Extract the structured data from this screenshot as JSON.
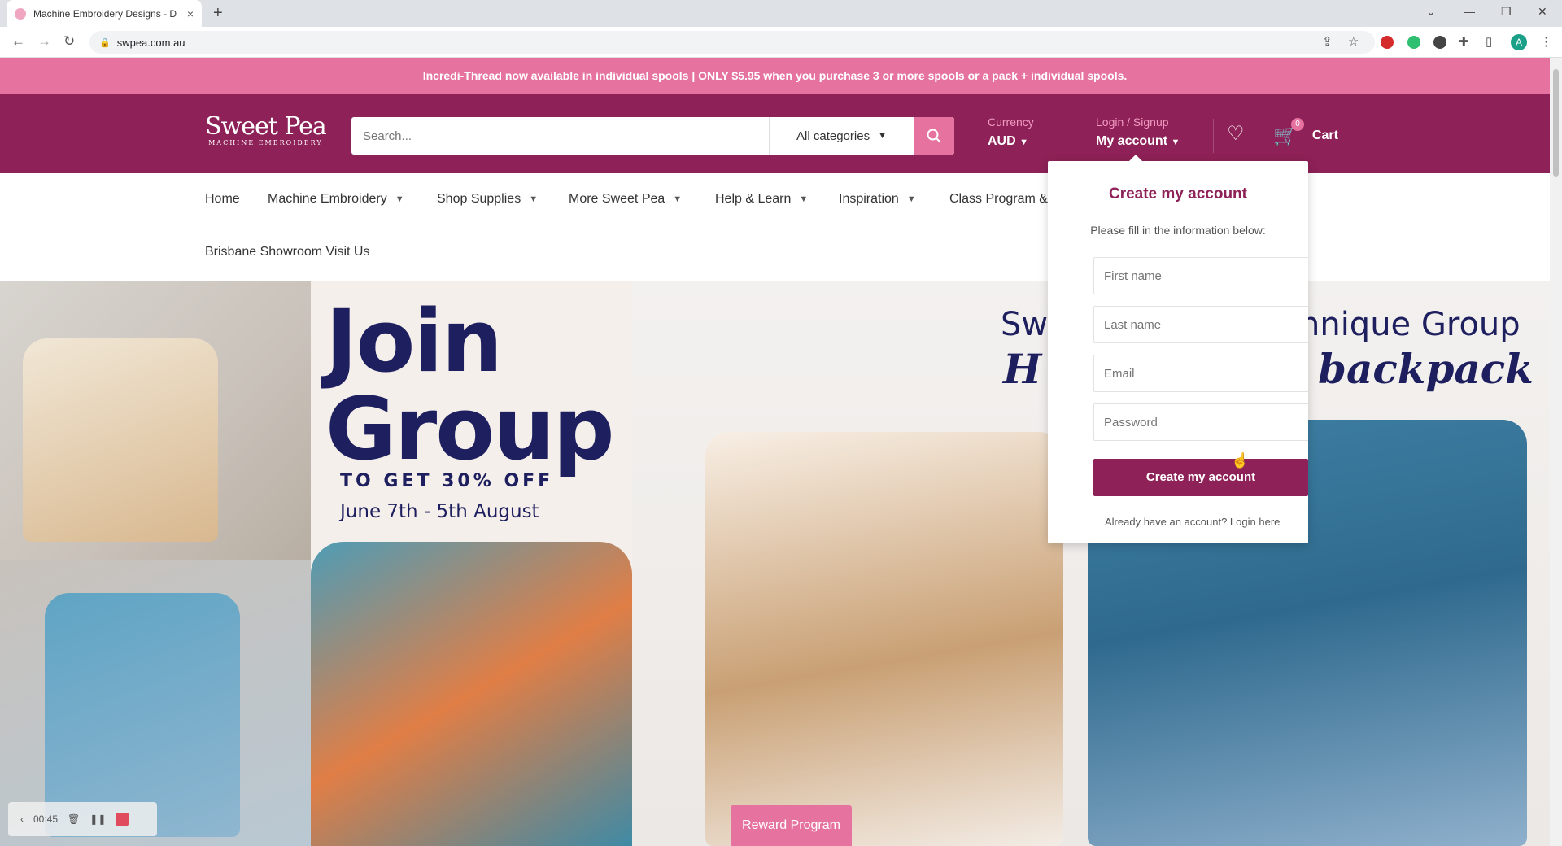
{
  "browser": {
    "tab_title": "Machine Embroidery Designs - D",
    "tab_close": "×",
    "new_tab": "+",
    "url": "swpea.com.au",
    "profile_initial": "A"
  },
  "announcement": "Incredi-Thread now available in individual spools | ONLY $5.95 when you purchase 3 or more spools or a pack + individual spools.",
  "header": {
    "logo_main": "Sweet Pea",
    "logo_sub": "MACHINE EMBROIDERY",
    "search_placeholder": "Search...",
    "category": "All categories",
    "currency_label": "Currency",
    "currency_value": "AUD",
    "login_label": "Login / Signup",
    "account_label": "My account",
    "cart_count": "0",
    "cart_label": "Cart"
  },
  "nav": {
    "home": "Home",
    "machine_embroidery": "Machine Embroidery",
    "shop_supplies": "Shop Supplies",
    "more_sweet_pea": "More Sweet Pea",
    "help_learn": "Help & Learn",
    "inspiration": "Inspiration",
    "class_program": "Class Program &",
    "showroom": "Brisbane Showroom Visit Us"
  },
  "hero": {
    "join_line1": "Join",
    "join_line2": "Group",
    "offer": "TO GET 30% OFF",
    "dates": "June 7th  - 5th August",
    "title_left": "Sw",
    "title_right": "chnique Group",
    "subtitle_left": "H",
    "subtitle_right": "backpack"
  },
  "account_dropdown": {
    "title": "Create my account",
    "description": "Please fill in the information below:",
    "first_name": "First name",
    "last_name": "Last name",
    "email": "Email",
    "password": "Password",
    "submit": "Create my account",
    "footer": "Already have an account? Login here"
  },
  "reward_button": "Reward Program",
  "recorder_time": "00:45",
  "colors": {
    "brand": "#8e2157",
    "accent": "#e6739f",
    "hero_text": "#1e1f5e"
  }
}
